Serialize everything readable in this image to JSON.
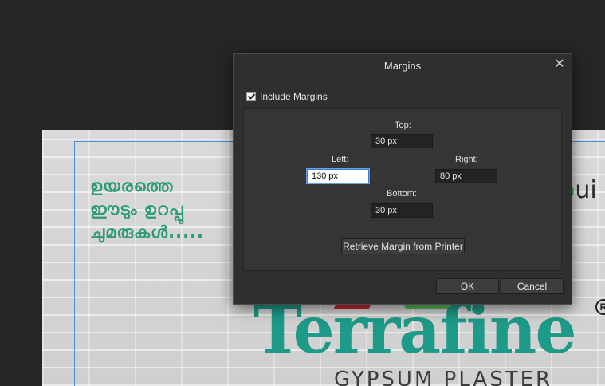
{
  "background": {
    "malayalam_lines": [
      "ഉയരത്തെ",
      "ഈടും ഉറപ്പു",
      "ചുമരുകൾ....."
    ],
    "brand_fragment_o": "o",
    "brand_fragment_rest": "ui",
    "brand_name": "Terrafine",
    "registered_mark": "R",
    "tagline": "GYPSUM PLASTER"
  },
  "dialog": {
    "title": "Margins",
    "close_glyph": "✕",
    "include_margins_label": "Include Margins",
    "include_margins_checked": true,
    "top_label": "Top:",
    "top_value": "30 px",
    "left_label": "Left:",
    "left_value": "130 px",
    "right_label": "Right:",
    "right_value": "80 px",
    "bottom_label": "Bottom:",
    "bottom_value": "30 px",
    "retrieve_button": "Retrieve Margin from Printer",
    "ok_button": "OK",
    "cancel_button": "Cancel"
  }
}
